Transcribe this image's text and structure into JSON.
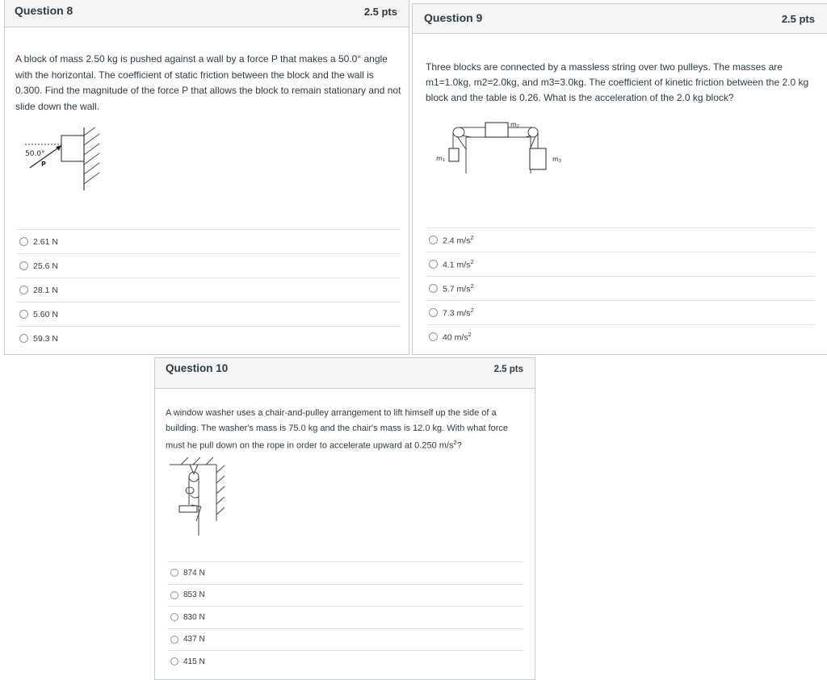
{
  "questions": [
    {
      "title": "Question 8",
      "points": "2.5 pts",
      "text": "A block of mass 2.50 kg is pushed against a wall by a force P that makes a 50.0° angle with the horizontal. The coefficient of static friction between the block and the wall is 0.300. Find the magnitude of the force P that allows the block to remain stationary and not slide down the wall.",
      "diagram": {
        "angle_label": "50.0°",
        "force_label": "P"
      },
      "answers": [
        {
          "label": "2.61 N"
        },
        {
          "label": "25.6 N"
        },
        {
          "label": "28.1 N"
        },
        {
          "label": "5.60 N"
        },
        {
          "label": "59.3 N"
        }
      ]
    },
    {
      "title": "Question 9",
      "points": "2.5 pts",
      "text": "Three blocks are connected by a massless string over two pulleys. The masses are m1=1.0kg, m2=2.0kg, and m3=3.0kg. The coefficient of kinetic friction between the 2.0 kg block and the table is 0.26. What is the acceleration of the 2.0 kg block?",
      "diagram": {
        "m1": "m",
        "m1_sub": "1",
        "m2": "m",
        "m2_sub": "2",
        "m3": "m",
        "m3_sub": "3"
      },
      "answers": [
        {
          "value": "2.4 m/s",
          "exp": "2"
        },
        {
          "value": "4.1 m/s",
          "exp": "2"
        },
        {
          "value": "5.7 m/s",
          "exp": "2"
        },
        {
          "value": "7.3 m/s",
          "exp": "2"
        },
        {
          "value": "40 m/s",
          "exp": "2"
        }
      ]
    },
    {
      "title": "Question 10",
      "points": "2.5 pts",
      "text_main": "A window washer uses a chair-and-pulley arrangement to lift himself up the side of a building. The washer's mass is 75.0 kg and the chair's mass is 12.0 kg. With what force must he pull down on the rope in order to accelerate upward at 0.250 m/s",
      "text_exp": "2",
      "text_end": "?",
      "answers": [
        {
          "label": "874 N"
        },
        {
          "label": "853 N"
        },
        {
          "label": "830 N"
        },
        {
          "label": "437 N"
        },
        {
          "label": "415 N"
        }
      ]
    }
  ]
}
